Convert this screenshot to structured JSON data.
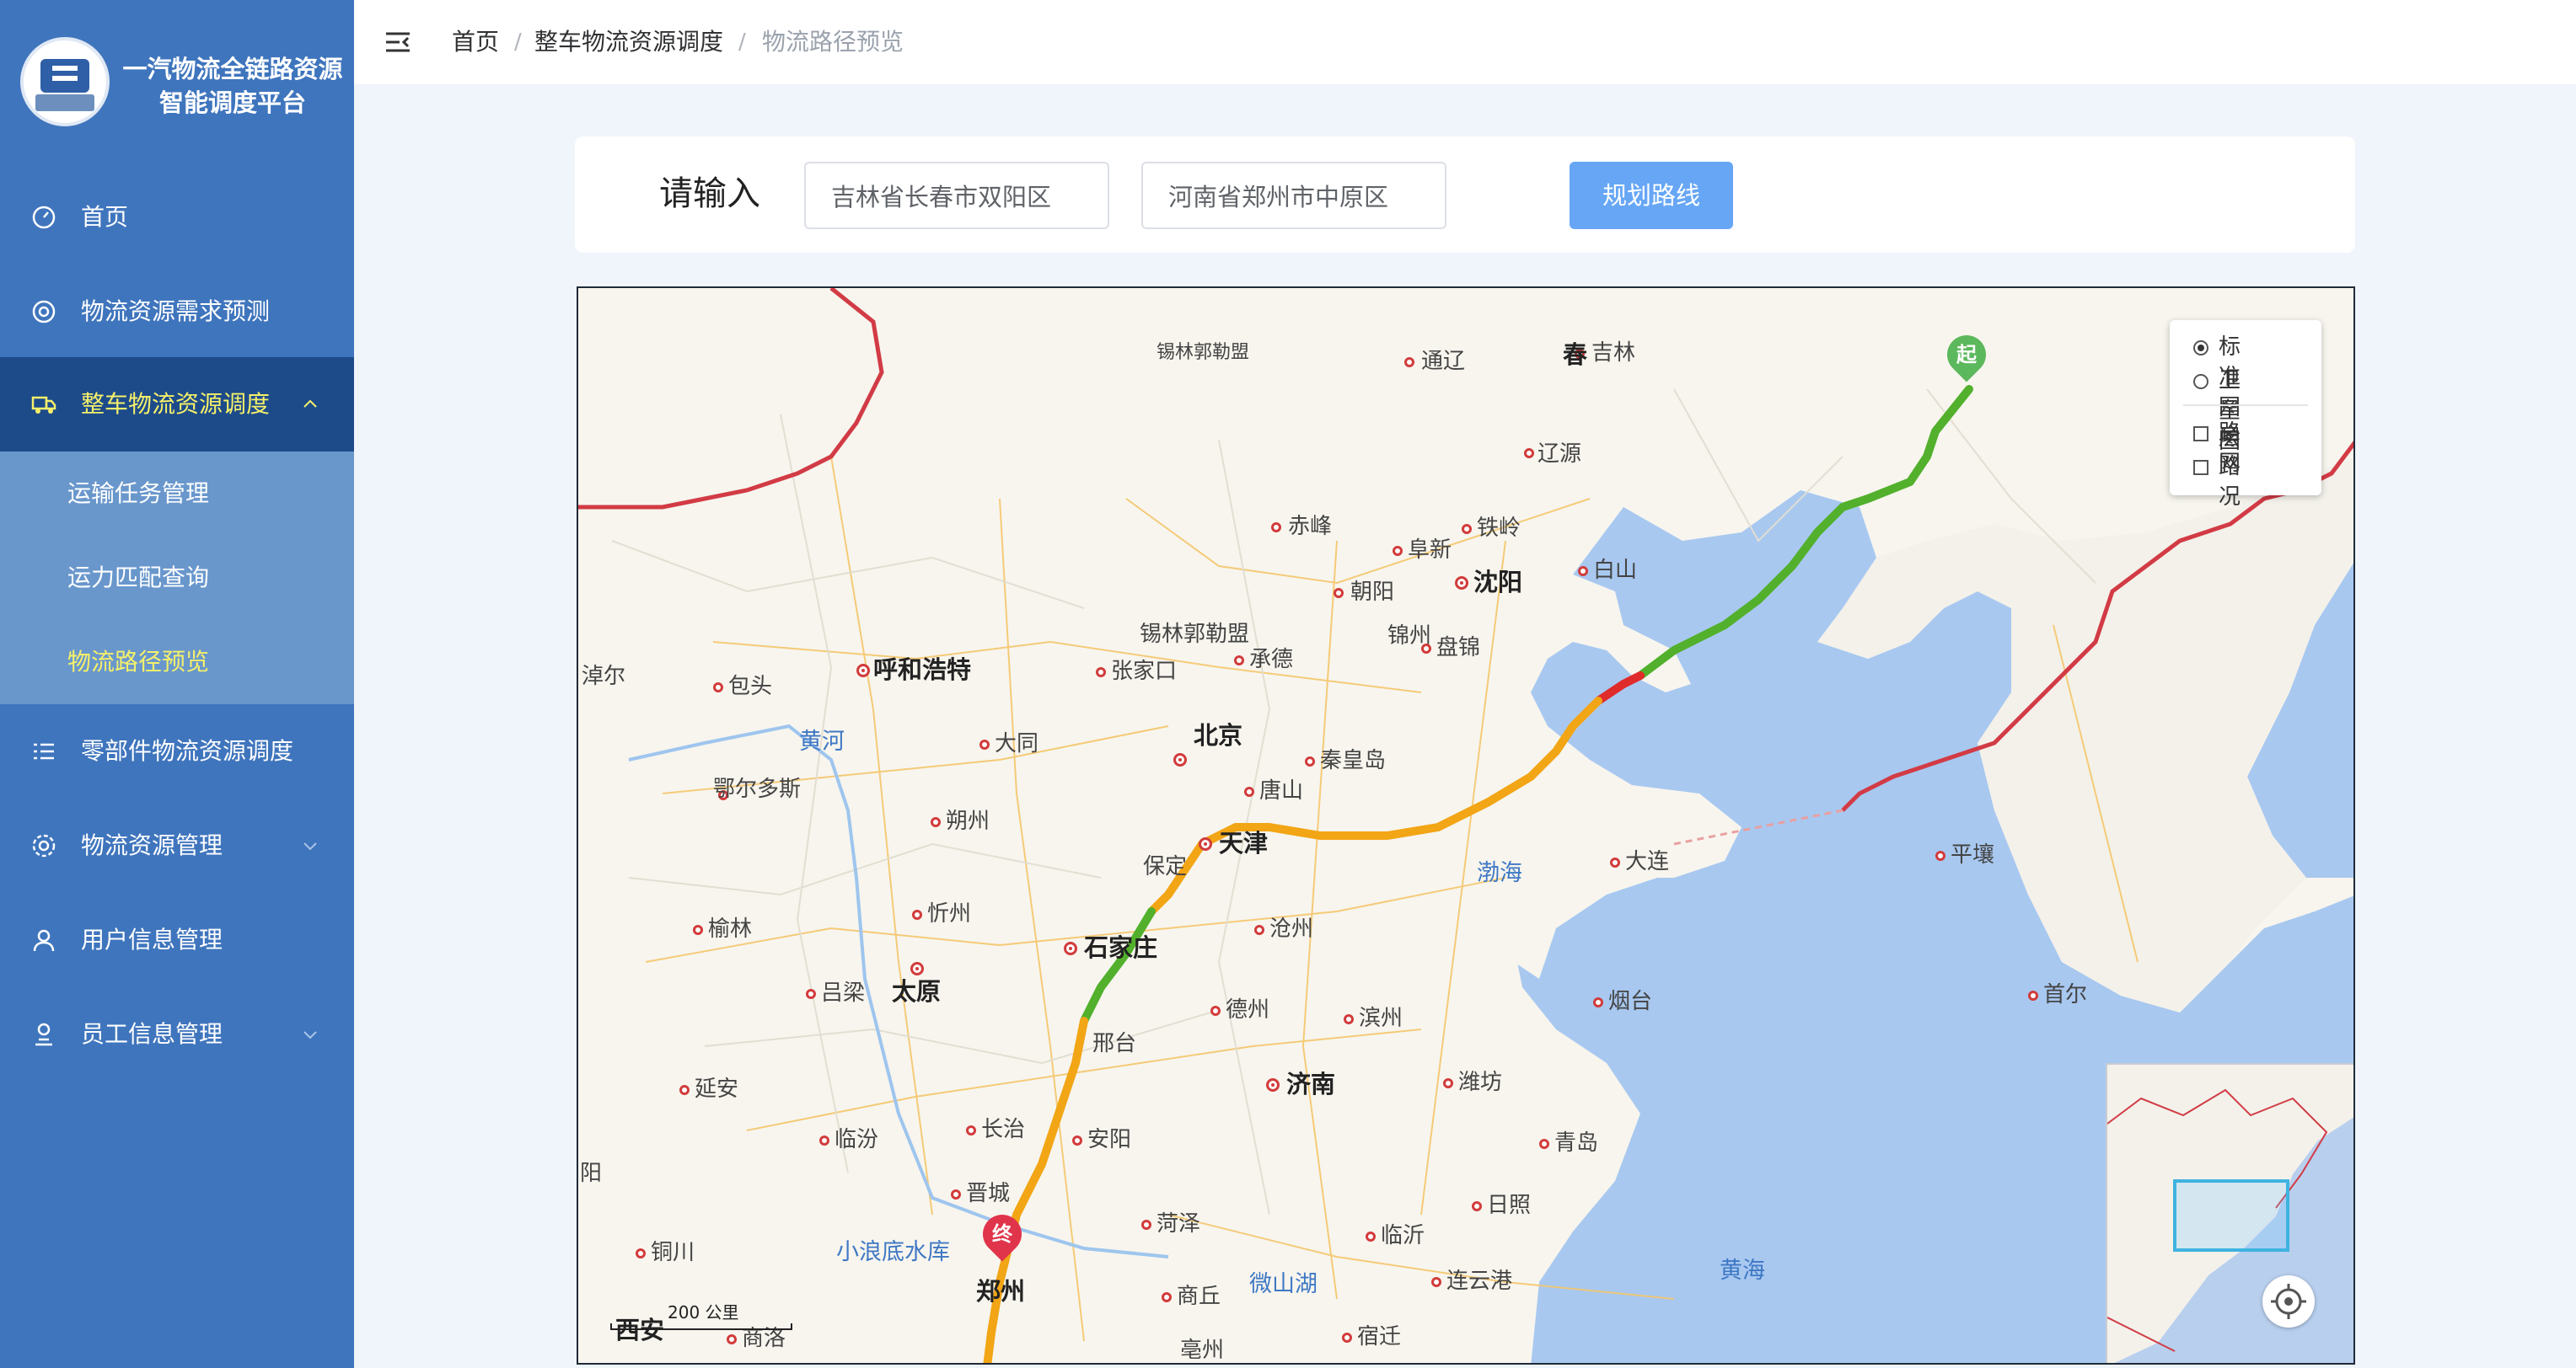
{
  "app": {
    "title_line1": "一汽物流全链路资源",
    "title_line2": "智能调度平台",
    "logo_icon": "company-logo-icon"
  },
  "sidebar": {
    "items": [
      {
        "label": "首页",
        "icon": "dashboard-icon"
      },
      {
        "label": "物流资源需求预测",
        "icon": "lifebuoy-icon"
      },
      {
        "label": "整车物流资源调度",
        "icon": "truck-icon",
        "active": true,
        "expanded": true,
        "children": [
          {
            "label": "运输任务管理"
          },
          {
            "label": "运力匹配查询"
          },
          {
            "label": "物流路径预览",
            "current": true
          }
        ]
      },
      {
        "label": "零部件物流资源调度",
        "icon": "list-icon"
      },
      {
        "label": "物流资源管理",
        "icon": "gear-icon"
      },
      {
        "label": "用户信息管理",
        "icon": "user-icon"
      },
      {
        "label": "员工信息管理",
        "icon": "employee-icon"
      }
    ]
  },
  "header": {
    "breadcrumb": [
      "首页",
      "整车物流资源调度",
      "物流路径预览"
    ],
    "separator": "/"
  },
  "route_form": {
    "label": "请输入",
    "origin_value": "吉林省长春市双阳区",
    "destination_value": "河南省郑州市中原区",
    "submit_label": "规划路线"
  },
  "map": {
    "layer_panel": {
      "layers": [
        {
          "label": "标准图层",
          "selected": true
        },
        {
          "label": "卫星图",
          "selected": false
        }
      ],
      "overlays": [
        {
          "label": "路网",
          "checked": false
        },
        {
          "label": "路况",
          "checked": false
        }
      ]
    },
    "start_marker": "起",
    "end_marker": "终",
    "scale_label": "200 公里",
    "route_colors": {
      "smooth": "#52b02c",
      "slow": "#f2a515",
      "congested": "#e02b2b"
    },
    "place_labels": {
      "xilinguole": "锡林郭勒盟",
      "tongliao": "通辽",
      "changchun": "春",
      "jilin": "吉林",
      "liaoyuan": "辽源",
      "tieling": "铁岭",
      "fuxin": "阜新",
      "chifeng": "赤峰",
      "baishan": "白山",
      "chaoyang": "朝阳",
      "shenyang": "沈阳",
      "jinzhou": "锦州",
      "panjin": "盘锦",
      "zhuoer": "淖尔",
      "baotou": "包头",
      "huhehaote": "呼和浩特",
      "zhangjiakou": "张家口",
      "chengde": "承德",
      "huanghe": "黄河",
      "datong": "大同",
      "beijing": "北京",
      "qinhuangdao": "秦皇岛",
      "ordos": "鄂尔多斯",
      "tangshan": "唐山",
      "shuozhou": "朔州",
      "tianjin": "天津",
      "dalian": "大连",
      "pyongyang": "平壤",
      "baoding": "保定",
      "bohai": "渤海",
      "xinzhou": "忻州",
      "yulin": "榆林",
      "cangzhou": "沧州",
      "shijiazhuang": "石家庄",
      "taiyuan": "太原",
      "lvliang": "吕梁",
      "dezhou": "德州",
      "binzhou": "滨州",
      "yantai": "烟台",
      "seoul": "首尔",
      "xingtai": "邢台",
      "yanan": "延安",
      "jinan": "济南",
      "weifang": "潍坊",
      "changzhi": "长治",
      "anyang": "安阳",
      "linfen": "临汾",
      "qingdao": "青岛",
      "jincheng": "晋城",
      "yang": "阳",
      "rizhao": "日照",
      "heze": "菏泽",
      "tongchuan": "铜川",
      "xiaolangdi": "小浪底水库",
      "linyi": "临沂",
      "zhengzhou": "郑州",
      "yellow_sea": "黄海",
      "weishan_lake": "微山湖",
      "lianyungang": "连云港",
      "shangqiu": "商丘",
      "xian": "西安",
      "shangluo": "商洛",
      "suqian": "宿迁",
      "bozhou": "亳州"
    }
  }
}
